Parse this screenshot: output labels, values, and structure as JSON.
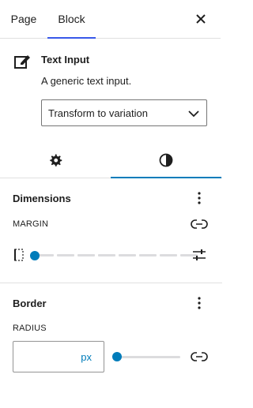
{
  "tabs": {
    "page": "Page",
    "block": "Block"
  },
  "block": {
    "title": "Text Input",
    "description": "A generic text input.",
    "transform_select": "Transform to variation"
  },
  "dimensions": {
    "title": "Dimensions",
    "margin_label": "MARGIN",
    "margin_value": 0,
    "margin_steps": 8
  },
  "border": {
    "title": "Border",
    "radius_label": "RADIUS",
    "radius_value": "",
    "radius_unit": "px",
    "radius_slider_value": 0
  },
  "colors": {
    "accent": "#007cba",
    "tab_underline": "#3858e9"
  },
  "icons": {
    "close": "close-icon",
    "block": "pencil-square-icon",
    "chevron": "chevron-down-icon",
    "settings": "gear-icon",
    "styles": "contrast-icon",
    "options": "more-vertical-icon",
    "link": "link-icon",
    "side": "box-side-icon",
    "custom": "sliders-icon"
  }
}
